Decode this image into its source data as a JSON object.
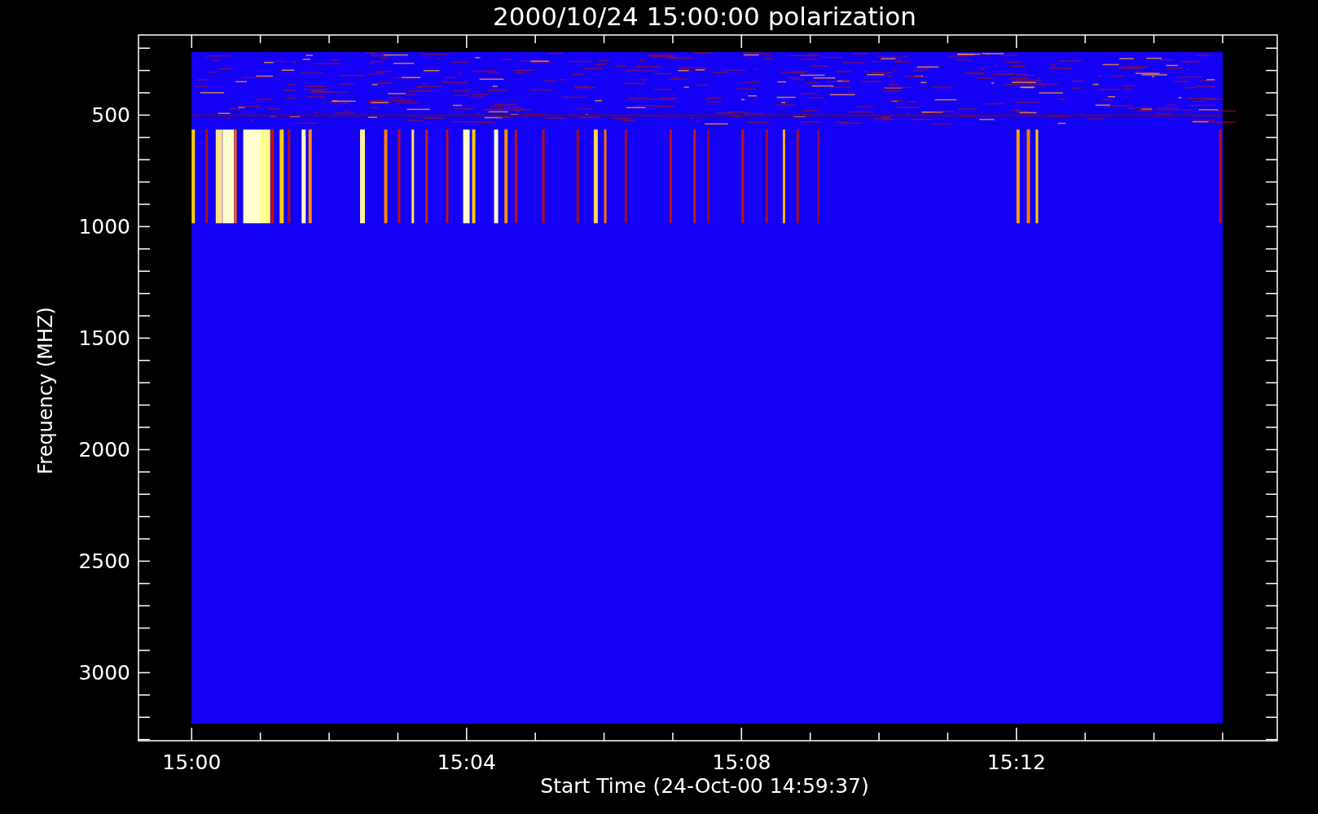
{
  "plot": {
    "title": "2000/10/24 15:00:00 polarization",
    "xlabel": "Start Time (24-Oct-00 14:59:37)",
    "ylabel": "Frequency (MHZ)",
    "yticks": [
      "500",
      "1000",
      "1500",
      "2000",
      "2500",
      "3000"
    ],
    "xticks": [
      "15:00",
      "15:04",
      "15:08",
      "15:12"
    ]
  }
}
